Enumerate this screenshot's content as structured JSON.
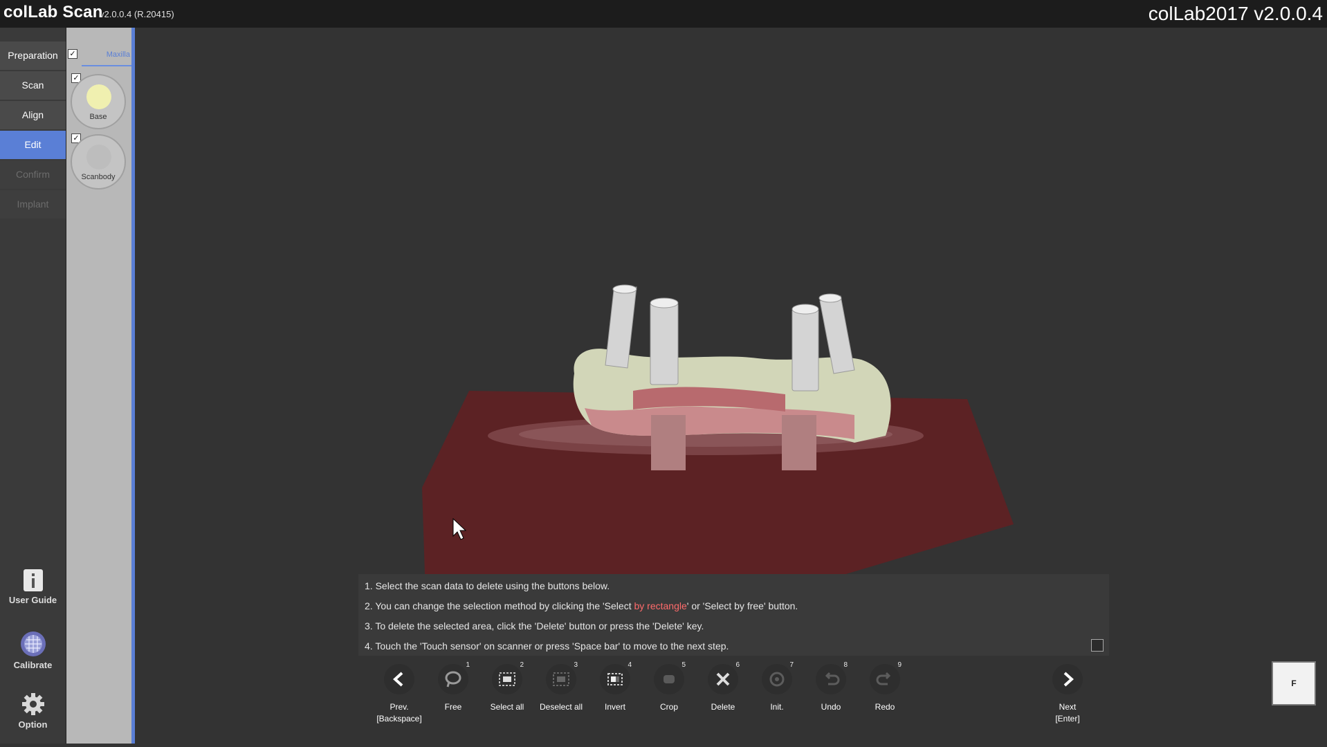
{
  "app": {
    "title": "colLab Scan",
    "version": "v2.0.0.4 (R.20415)",
    "title_right": "colLab2017 v2.0.0.4"
  },
  "nav": {
    "items": [
      {
        "label": "Preparation",
        "state": "normal"
      },
      {
        "label": "Scan",
        "state": "normal"
      },
      {
        "label": "Align",
        "state": "normal"
      },
      {
        "label": "Edit",
        "state": "active"
      },
      {
        "label": "Confirm",
        "state": "disabled"
      },
      {
        "label": "Implant",
        "state": "disabled"
      }
    ],
    "tools": [
      {
        "label": "User Guide",
        "icon": "info-icon"
      },
      {
        "label": "Calibrate",
        "icon": "calibrate-icon"
      },
      {
        "label": "Option",
        "icon": "gear-icon"
      }
    ]
  },
  "layers": {
    "tab_label": "Maxilla",
    "items": [
      {
        "label": "Base",
        "color": "#f0f0b0",
        "checked": true
      },
      {
        "label": "Scanbody",
        "color": "#bdbdbd",
        "checked": true
      }
    ]
  },
  "instructions": {
    "line1": "1. Select the scan data to delete using the buttons below.",
    "line2_pre": "2. You can change the selection method by clicking the 'Select ",
    "line2_hl": "by rectangle",
    "line2_post": "' or 'Select by free' button.",
    "line3": "3. To delete the selected area, click the 'Delete' button or press the 'Delete' key.",
    "line4": "4. Touch the 'Touch sensor' on scanner or press 'Space bar' to move to the next step."
  },
  "toolbar": {
    "prev_label": "Prev.",
    "prev_key": "[Backspace]",
    "next_label": "Next",
    "next_key": "[Enter]",
    "buttons": [
      {
        "label": "Free",
        "num": "1",
        "icon": "lasso-icon"
      },
      {
        "label": "Select all",
        "num": "2",
        "icon": "select-all-icon"
      },
      {
        "label": "Deselect all",
        "num": "3",
        "icon": "deselect-all-icon"
      },
      {
        "label": "Invert",
        "num": "4",
        "icon": "invert-icon"
      },
      {
        "label": "Crop",
        "num": "5",
        "icon": "crop-icon"
      },
      {
        "label": "Delete",
        "num": "6",
        "icon": "delete-icon"
      },
      {
        "label": "Init.",
        "num": "7",
        "icon": "init-icon"
      },
      {
        "label": "Undo",
        "num": "8",
        "icon": "undo-icon"
      },
      {
        "label": "Redo",
        "num": "9",
        "icon": "redo-icon"
      }
    ]
  },
  "view_cube": {
    "face": "F"
  },
  "colors": {
    "accent": "#5a7fd6",
    "selection": "#6b1f1f",
    "model": "#d8dcc8"
  }
}
